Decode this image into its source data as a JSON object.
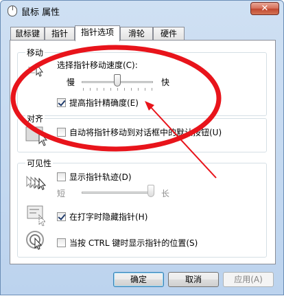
{
  "window": {
    "title": "鼠标 属性",
    "close_label": "✕"
  },
  "tabs": [
    {
      "label": "鼠标键",
      "active": false
    },
    {
      "label": "指针",
      "active": false
    },
    {
      "label": "指针选项",
      "active": true
    },
    {
      "label": "滑轮",
      "active": false
    },
    {
      "label": "硬件",
      "active": false
    }
  ],
  "motion": {
    "group_label": "移动",
    "speed_label": "选择指针移动速度(C):",
    "slow_label": "慢",
    "fast_label": "快",
    "speed_value_fraction": 0.5,
    "precision_label": "提高指针精确度(E)",
    "precision_checked": true
  },
  "snap": {
    "group_label": "对齐",
    "snap_label": "自动将指针移动到对话框中的默认按钮(U)",
    "snap_checked": false
  },
  "visibility": {
    "group_label": "可见性",
    "trails_label": "显示指针轨迹(D)",
    "trails_checked": false,
    "short_label": "短",
    "long_label": "长",
    "trails_value_fraction": 1.0,
    "hide_label": "在打字时隐藏指针(H)",
    "hide_checked": true,
    "ctrl_label": "当按 CTRL 键时显示指针的位置(S)",
    "ctrl_checked": false
  },
  "buttons": {
    "ok": "确定",
    "cancel": "取消",
    "apply": "应用(A)"
  },
  "colors": {
    "annotation_red": "#e8141b"
  }
}
